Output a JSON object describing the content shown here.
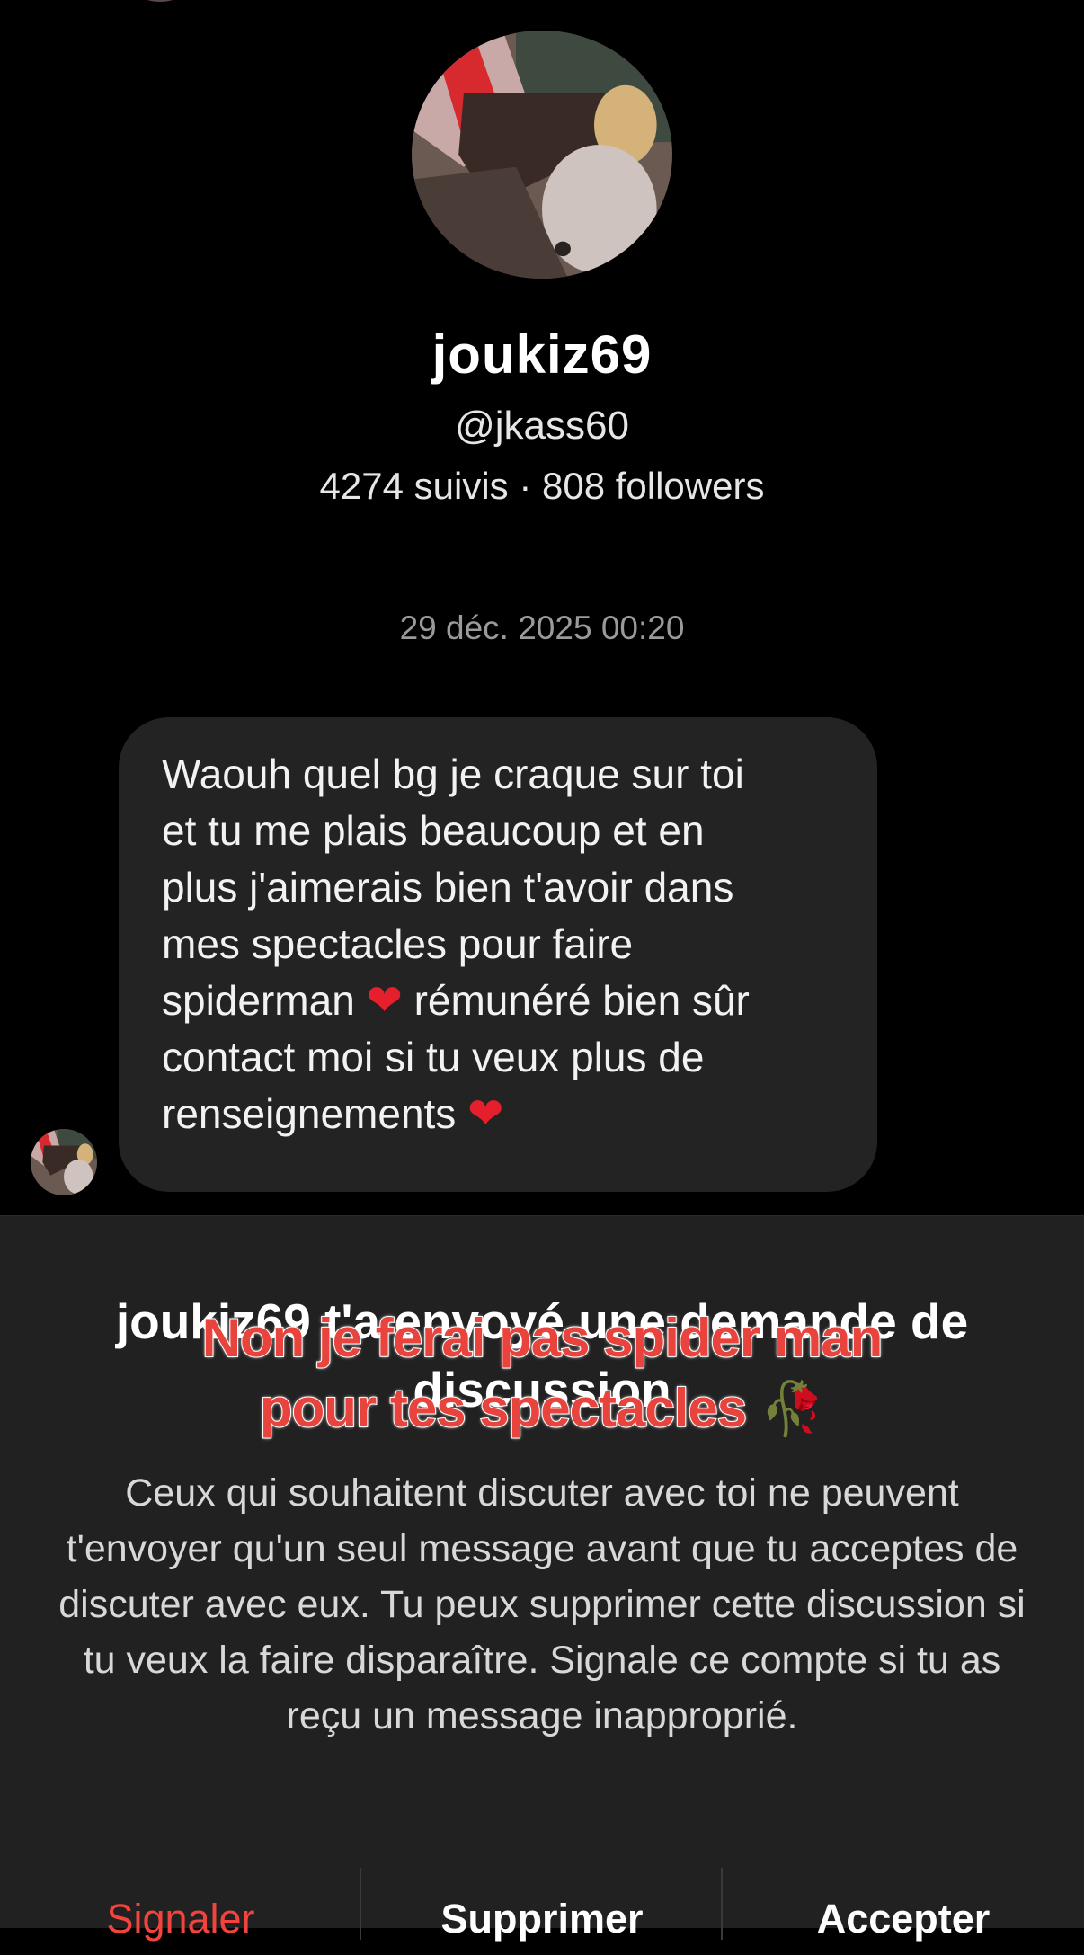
{
  "profile": {
    "display_name": "joukiz69",
    "handle": "@jkass60",
    "stats": "4274 suivis · 808 followers"
  },
  "conversation": {
    "timestamp": "29 déc. 2025 00:20",
    "message_lines": [
      "Waouh quel bg je craque sur toi",
      "et tu me plais beaucoup et en",
      "plus j'aimerais bien t'avoir dans",
      "mes spectacles pour faire",
      "spiderman",
      "rémunéré bien sûr",
      "contact moi si tu veux plus de",
      "renseignements"
    ],
    "heart_emoji": "❤"
  },
  "request_sheet": {
    "title": "joukiz69 t'a envoyé une demande de discussion",
    "body": "Ceux qui souhaitent discuter avec toi ne peuvent t'envoyer qu'un seul message avant que tu acceptes de discuter avec eux. Tu peux supprimer cette discussion si tu veux la faire disparaître. Signale ce compte si tu as reçu un message inapproprié.",
    "actions": {
      "report": "Signaler",
      "delete": "Supprimer",
      "accept": "Accepter"
    }
  },
  "overlay_caption": {
    "line1": "Non je ferai pas spider man",
    "line2": "pour tes spectacles",
    "emoji": "🥀"
  },
  "colors": {
    "background": "#000000",
    "bubble": "#232323",
    "sheet": "#212121",
    "danger": "#f2433c",
    "caption": "#e8433c"
  },
  "icons": {
    "avatar": "profile-photo",
    "heart": "red-heart-emoji",
    "rose": "wilted-rose-emoji"
  }
}
